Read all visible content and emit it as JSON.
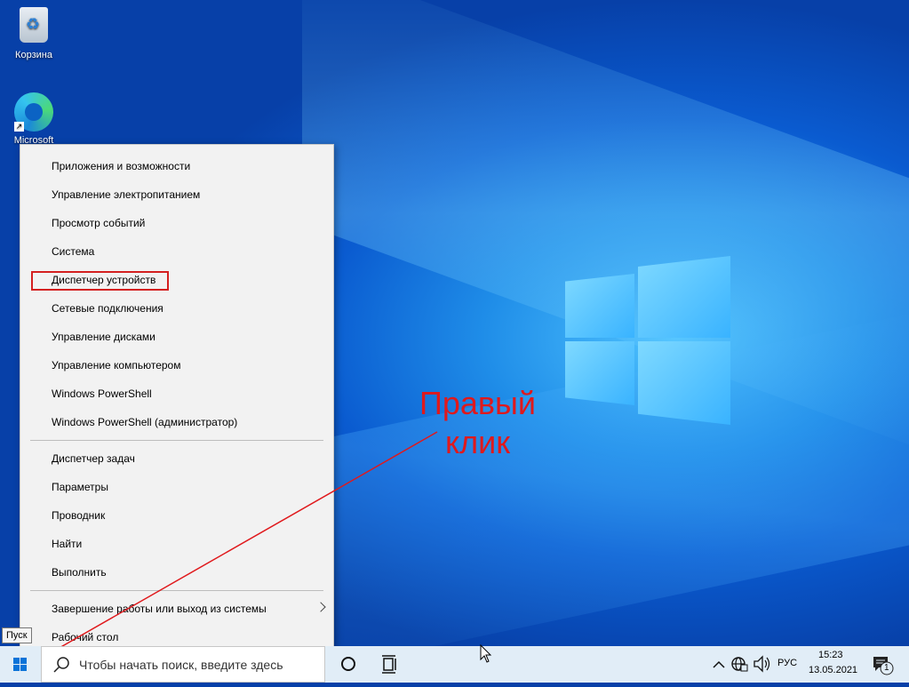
{
  "desktop": {
    "icons": [
      {
        "label": "Корзина",
        "icon": "recycle-bin-icon"
      },
      {
        "label": "Microsoft",
        "icon": "edge-icon"
      }
    ]
  },
  "context_menu": {
    "group1": [
      "Приложения и возможности",
      "Управление электропитанием",
      "Просмотр событий",
      "Система",
      "Диспетчер устройств",
      "Сетевые подключения",
      "Управление дисками",
      "Управление компьютером",
      "Windows PowerShell",
      "Windows PowerShell (администратор)"
    ],
    "group2": [
      "Диспетчер задач",
      "Параметры",
      "Проводник",
      "Найти",
      "Выполнить"
    ],
    "group3": [
      "Завершение работы или выход из системы",
      "Рабочий стол"
    ],
    "highlighted_item": "Диспетчер устройств"
  },
  "annotation": {
    "line1": "Правый",
    "line2": "клик",
    "color": "#e0191c"
  },
  "start_tooltip": "Пуск",
  "taskbar": {
    "search_placeholder": "Чтобы начать поиск, введите здесь",
    "language": "РУС",
    "time": "15:23",
    "date": "13.05.2021",
    "notification_count": "1",
    "icons": [
      "windows-start-icon",
      "search-icon",
      "cortana-icon",
      "task-view-icon",
      "chevron-up-icon",
      "network-icon",
      "volume-icon",
      "notification-icon"
    ]
  },
  "colors": {
    "taskbar": "#e1edf7",
    "accent": "#0a73d8",
    "highlight_border": "#d42020"
  }
}
